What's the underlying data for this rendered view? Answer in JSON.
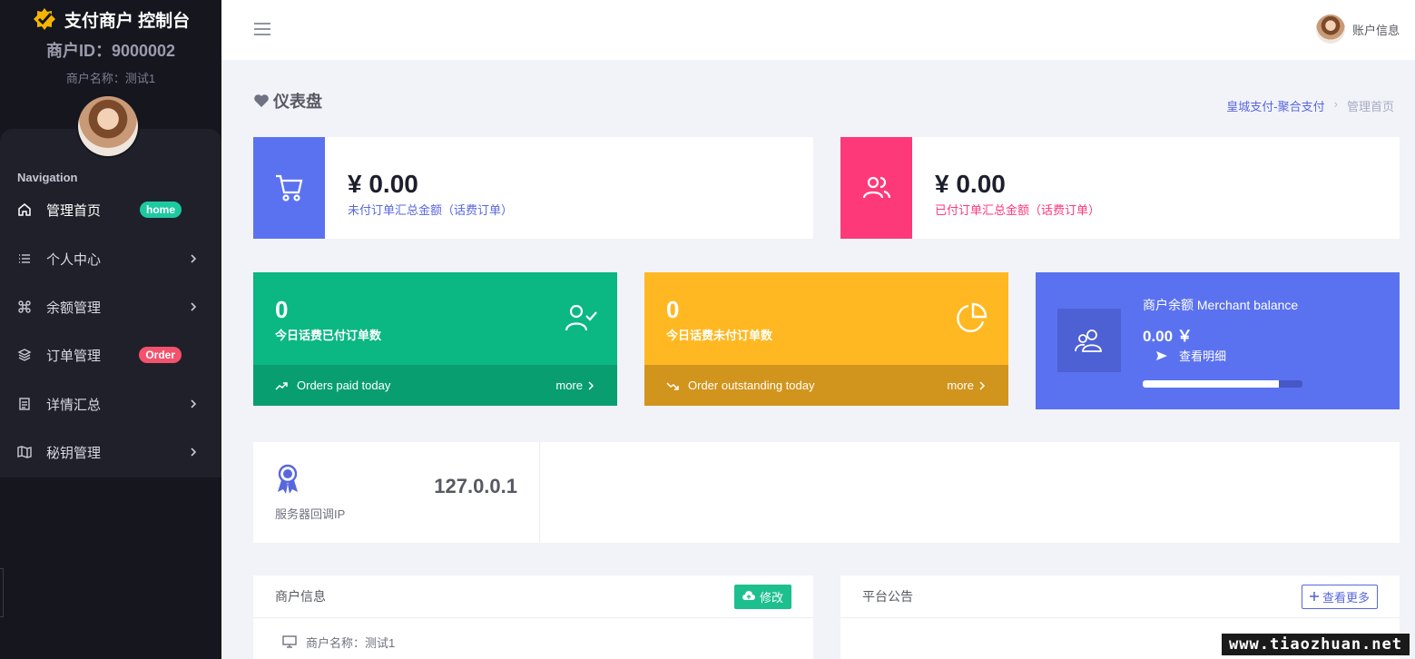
{
  "sidebar": {
    "brand_title": "支付商户 控制台",
    "merchant_id": "商户ID：9000002",
    "merchant_name": "商户名称：测试1",
    "nav_title": "Navigation",
    "items": [
      {
        "label": "管理首页",
        "badge": "home",
        "icon": "home-icon"
      },
      {
        "label": "个人中心",
        "icon": "list-icon"
      },
      {
        "label": "余额管理",
        "icon": "command-icon"
      },
      {
        "label": "订单管理",
        "badge": "Order",
        "icon": "layers-icon"
      },
      {
        "label": "详情汇总",
        "icon": "document-icon"
      },
      {
        "label": "秘钥管理",
        "icon": "map-icon"
      }
    ]
  },
  "header": {
    "user_label": "账户信息"
  },
  "subheader": {
    "title": "仪表盘",
    "breadcrumb": [
      "皇城支付-聚合支付",
      "管理首页"
    ]
  },
  "stats": {
    "unpaid": {
      "amount": "¥ 0.00",
      "desc": "未付订单汇总金额（话费订单）",
      "color": "#5867dd",
      "icon": "cart-icon"
    },
    "paid": {
      "amount": "¥ 0.00",
      "desc": "已付订单汇总金额（话费订单）",
      "color": "#fd397a",
      "icon": "users-icon"
    }
  },
  "today_paid": {
    "count": "0",
    "label": "今日话费已付订单数",
    "footer": "Orders paid today",
    "more": "more",
    "color": "#0bb783",
    "footer_color": "#099e70"
  },
  "today_unpaid": {
    "count": "0",
    "label": "今日话费未付订单数",
    "footer": "Order outstanding today",
    "more": "more",
    "color": "#ffb822",
    "footer_color": "#d1941c"
  },
  "balance": {
    "title": "商户余额 Merchant balance",
    "amount": "0.00 ￥",
    "link": "查看明细",
    "progress": 0.85,
    "color": "#5b72f0"
  },
  "server": {
    "ip": "127.0.0.1",
    "label": "服务器回调IP"
  },
  "merchant_panel": {
    "title": "商户信息",
    "edit_label": "修改",
    "row": "商户名称：测试1"
  },
  "notice_panel": {
    "title": "平台公告",
    "more_label": "查看更多"
  },
  "watermark": "www.tiaozhuan.net"
}
